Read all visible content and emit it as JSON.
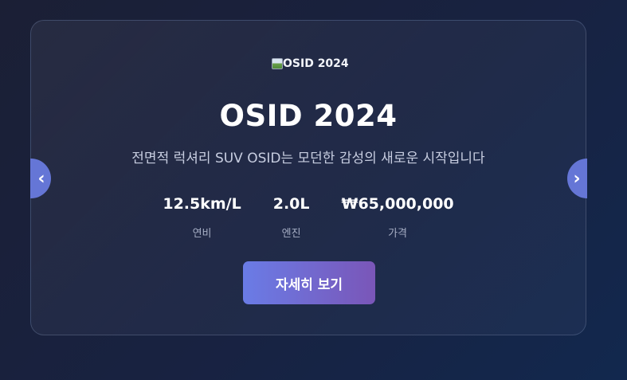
{
  "slide": {
    "image_alt": "OSID 2024",
    "title": "OSID 2024",
    "subtitle": "전면적 럭셔리 SUV OSID는 모던한 감성의 새로운 시작입니다",
    "stats": [
      {
        "value": "12.5km/L",
        "label": "연비"
      },
      {
        "value": "2.0L",
        "label": "엔진"
      },
      {
        "value": "₩65,000,000",
        "label": "가격"
      }
    ],
    "detail_button_label": "자세히 보기"
  },
  "nav": {
    "prev_icon": "chevron-left-icon",
    "prev_glyph": "‹",
    "next_icon": "chevron-right-icon",
    "next_glyph": "›"
  },
  "colors": {
    "accent": "#6576d6",
    "button_gradient_start": "#6a7ce6",
    "button_gradient_end": "#7a56b8"
  }
}
